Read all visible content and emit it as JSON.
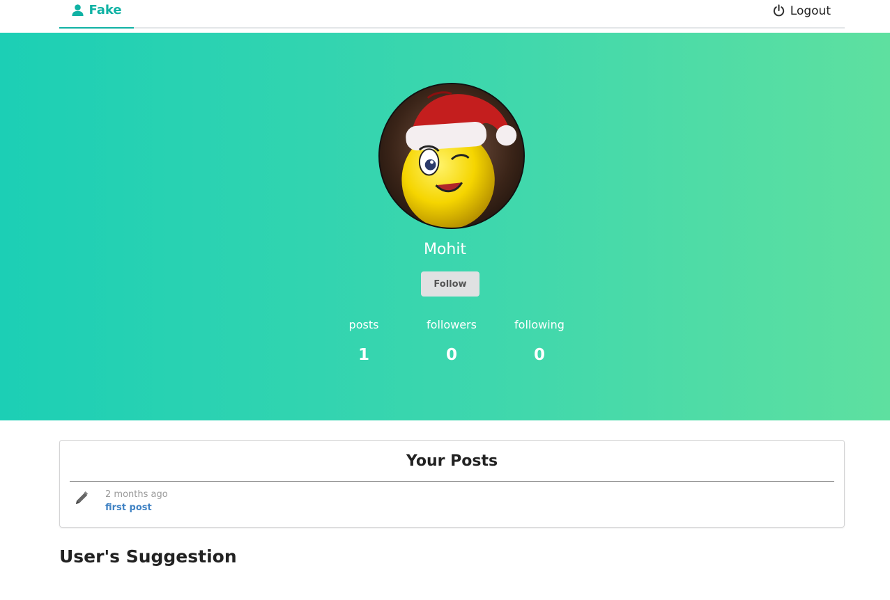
{
  "nav": {
    "brand_label": "Fake",
    "brand_icon": "user-icon",
    "logout_label": "Logout",
    "logout_icon": "power-icon"
  },
  "profile": {
    "name": "Mohit",
    "avatar": "winking-emoji-santa-hat-photo",
    "follow_label": "Follow",
    "stats": [
      {
        "label": "posts",
        "value": "1"
      },
      {
        "label": "followers",
        "value": "0"
      },
      {
        "label": "following",
        "value": "0"
      }
    ]
  },
  "posts": {
    "title": "Your Posts",
    "items": [
      {
        "icon": "pencil-icon",
        "time": "2 months ago",
        "title": "first post"
      }
    ]
  },
  "suggestions": {
    "title": "User's Suggestion"
  },
  "colors": {
    "accent": "#10b2a4",
    "gradient_start": "#1ccfb5",
    "gradient_end": "#5ee0a0",
    "link": "#4183c4"
  }
}
